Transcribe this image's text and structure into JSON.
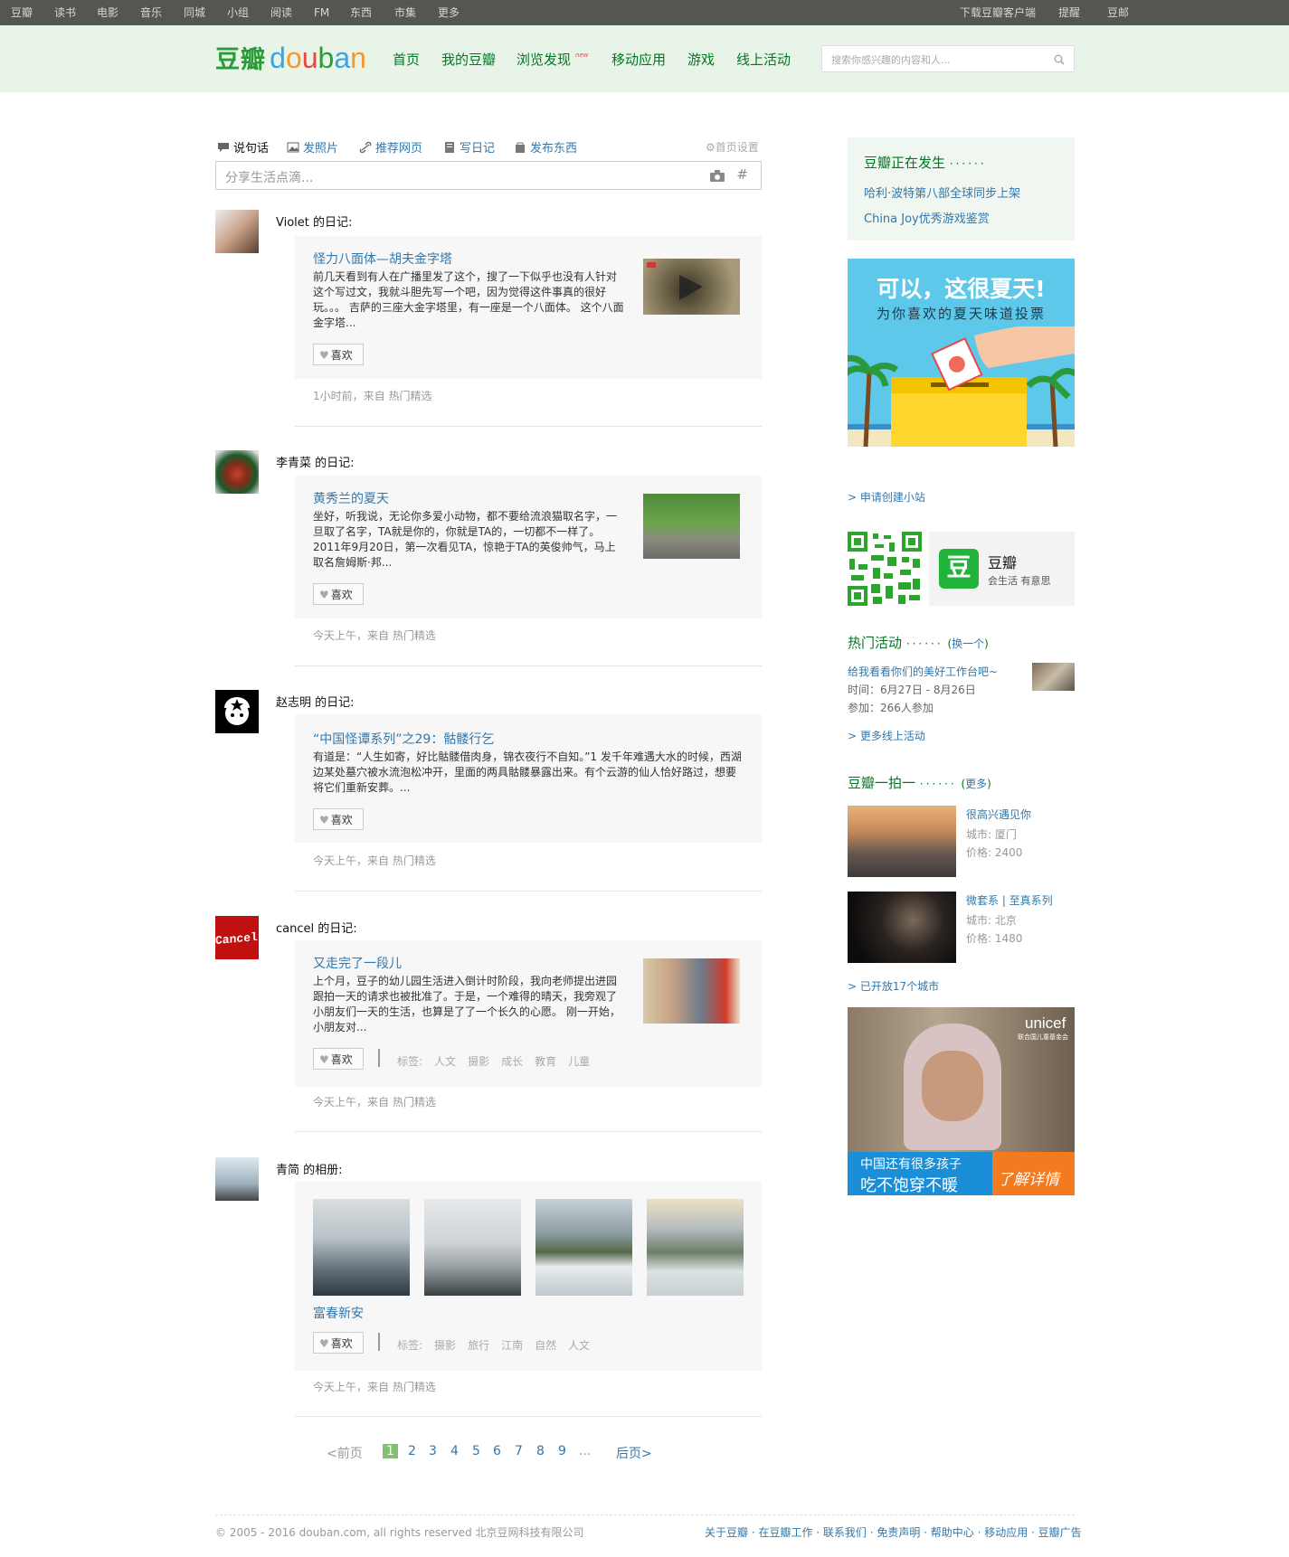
{
  "topbar": {
    "left": [
      "豆瓣",
      "读书",
      "电影",
      "音乐",
      "同城",
      "小组",
      "阅读",
      "FM",
      "东西",
      "市集",
      "更多"
    ],
    "right": [
      "下载豆瓣客户端",
      "提醒",
      "豆邮"
    ]
  },
  "header": {
    "logo_cn": "豆瓣",
    "logo_en": "douban",
    "nav": [
      "首页",
      "我的豆瓣",
      "浏览发现",
      "移动应用",
      "游戏",
      "线上活动"
    ],
    "nav_badge": "new",
    "search_placeholder": "搜索你感兴趣的内容和人..."
  },
  "toolbar": {
    "items": [
      "说句话",
      "发照片",
      "推荐网页",
      "写日记",
      "发布东西"
    ],
    "settings": "首页设置",
    "share_placeholder": "分享生活点滴...",
    "hash": "#"
  },
  "feed": [
    {
      "who": "Violet 的日记:",
      "title": "怪力八面体—胡夫金字塔",
      "text": "前几天看到有人在广播里发了这个，搜了一下似乎也没有人针对这个写过文，我就斗胆先写一个吧，因为觉得这件事真的很好玩。。。 吉萨的三座大金字塔里，有一座是一个八面体。 这个八面金字塔...",
      "like": "喜欢",
      "meta": "1小时前，来自 热门精选"
    },
    {
      "who": "李青菜 的日记:",
      "title": "黄秀兰的夏天",
      "text": "坐好，听我说，无论你多爱小动物，都不要给流浪猫取名字，一旦取了名字，TA就是你的，你就是TA的，一切都不一样了。2011年9月20日，第一次看见TA，惊艳于TA的英俊帅气，马上取名詹姆斯·邦...",
      "like": "喜欢",
      "meta": "今天上午，来自 热门精选"
    },
    {
      "who": "赵志明 的日记:",
      "title": "“中国怪谭系列”之29：骷髅行乞",
      "text": "有道是：“人生如寄，好比骷髅借肉身，锦衣夜行不自知。”1 发千年难遇大水的时候，西湖边某处墓穴被水流泡松冲开，里面的两具骷髅暴露出来。有个云游的仙人恰好路过，想要将它们重新安葬。...",
      "like": "喜欢",
      "meta": "今天上午，来自 热门精选"
    },
    {
      "who": "cancel 的日记:",
      "title": "又走完了一段儿",
      "text": "上个月，豆子的幼儿园生活进入倒计时阶段，我向老师提出进园跟拍一天的请求也被批准了。于是，一个难得的晴天，我旁观了小朋友们一天的生活，也算是了了一个长久的心愿。 刚一开始，小朋友对...",
      "like": "喜欢",
      "tags_label": "标签:",
      "tags": [
        "人文",
        "摄影",
        "成长",
        "教育",
        "儿童"
      ],
      "meta": "今天上午，来自 热门精选"
    },
    {
      "who": "青简 的相册:",
      "title": "富春新安",
      "like": "喜欢",
      "tags_label": "标签:",
      "tags": [
        "摄影",
        "旅行",
        "江南",
        "自然",
        "人文"
      ],
      "meta": "今天上午，来自 热门精选"
    }
  ],
  "pager": {
    "prev": "<前页",
    "pages": [
      "1",
      "2",
      "3",
      "4",
      "5",
      "6",
      "7",
      "8",
      "9"
    ],
    "ellipsis": "...",
    "next": "后页>"
  },
  "side": {
    "happening_title": "豆瓣正在发生",
    "happening": [
      "哈利·波特第八部全球同步上架",
      "China Joy优秀游戏鉴赏"
    ],
    "ad1_line1": "可以，这很夏天!",
    "ad1_line2": "为你喜欢的夏天味道投票",
    "create_site": "> 申请创建小站",
    "app_name": "豆瓣",
    "app_icon": "豆",
    "app_slogan": "会生活 有意思",
    "hot_title": "热门活动",
    "hot_switch": "换一个",
    "hot_event": "给我看看你们的美好工作台吧~",
    "hot_time": "时间：6月27日 - 8月26日",
    "hot_join": "参加：266人参加",
    "more_events": "> 更多线上活动",
    "paizhao_title": "豆瓣一拍一",
    "paizhao_more": "更多",
    "photographers": [
      {
        "name": "很高兴遇见你",
        "city": "城市: 厦门",
        "price": "价格: 2400"
      },
      {
        "name": "微套系 | 至真系列",
        "city": "城市: 北京",
        "price": "价格: 1480"
      }
    ],
    "cities": "> 已开放17个城市",
    "unicef_brand": "unicef",
    "unicef_sub": "联合国儿童基金会",
    "unicef_line1": "中国还有很多孩子",
    "unicef_line2": "吃不饱穿不暖",
    "unicef_cta": "了解详情"
  },
  "footer": {
    "copyright": "© 2005 - 2016 douban.com, all rights reserved 北京豆网科技有限公司",
    "links": "关于豆瓣 · 在豆瓣工作 · 联系我们 · 免责声明 · 帮助中心 · 移动应用 · 豆瓣广告"
  }
}
